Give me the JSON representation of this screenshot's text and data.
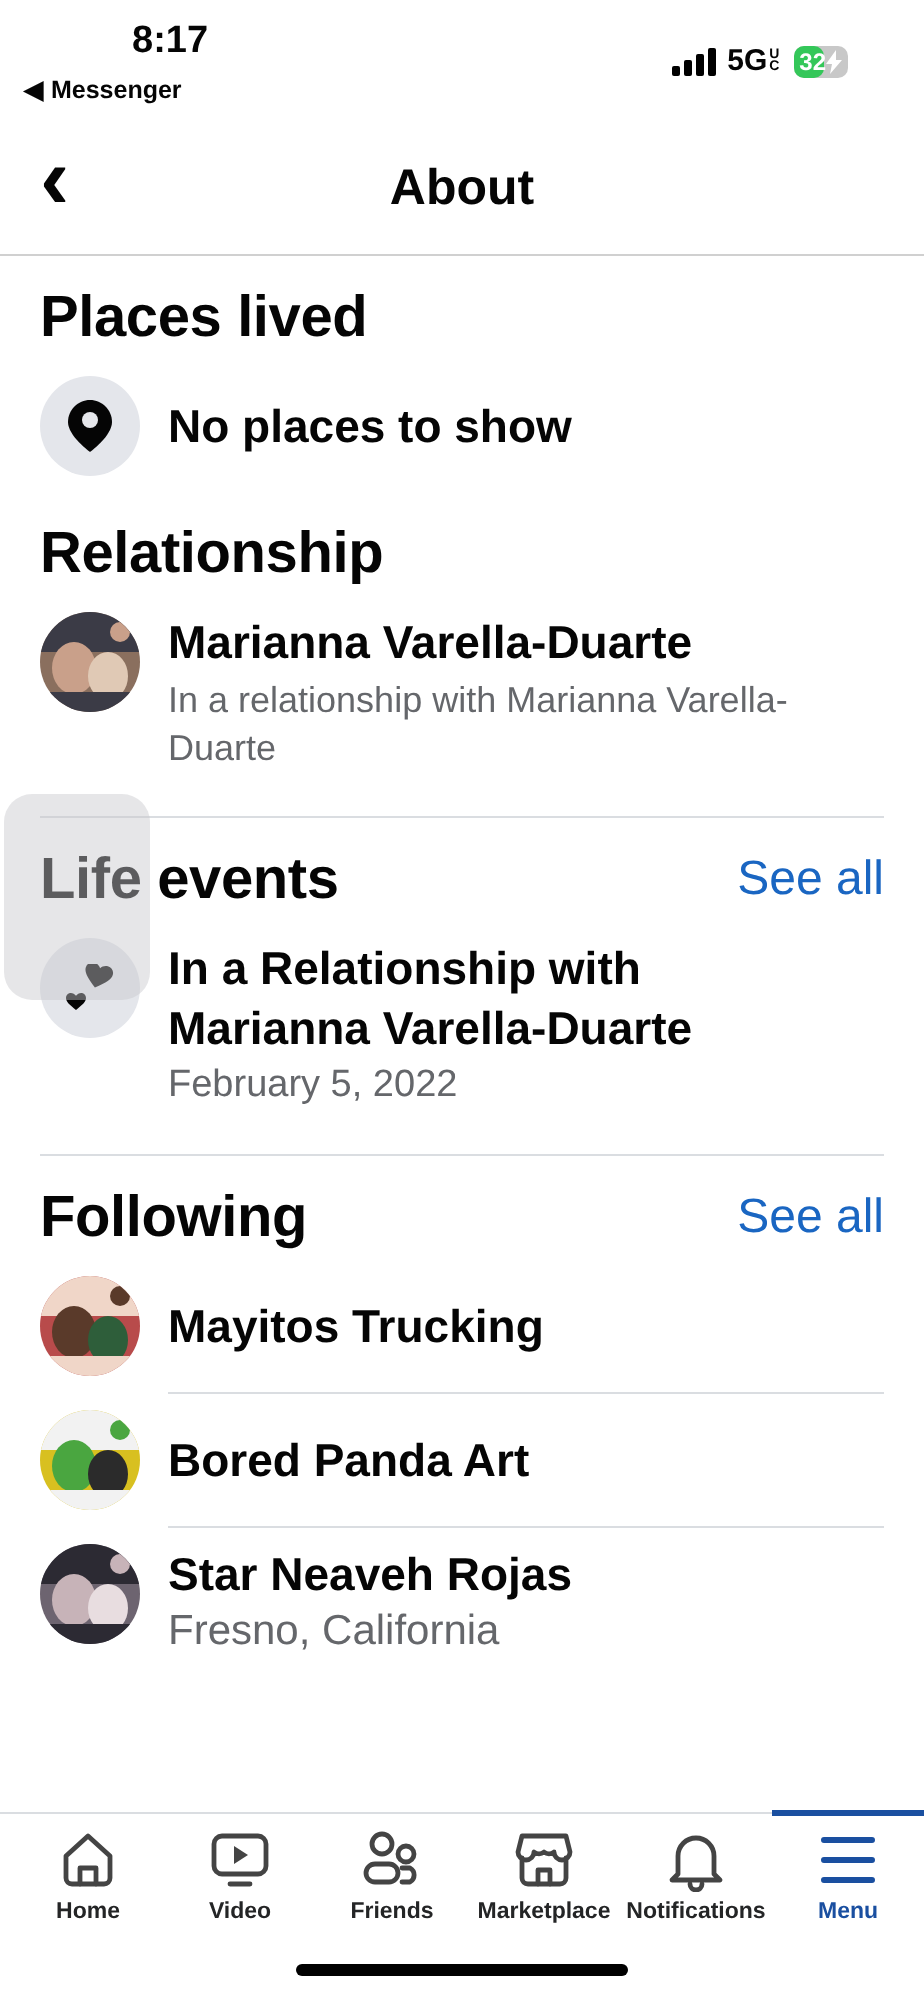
{
  "status_bar": {
    "time": "8:17",
    "back_app": "◀ Messenger",
    "network": "5G",
    "network_badge": "UC",
    "battery": "32",
    "charging": true
  },
  "header": {
    "back": "‹",
    "title": "About"
  },
  "sections": [
    {
      "heading": "Places lived",
      "divider": false,
      "items": [
        {
          "kind": "pin",
          "title": "No places to show"
        }
      ]
    },
    {
      "heading": "Relationship",
      "divider": true,
      "items": [
        {
          "kind": "picture",
          "title": "Marianna Varella-Duarte",
          "subtitle": "In a relationship with Marianna Varella-Duarte"
        }
      ]
    },
    {
      "heading": "Life events",
      "see_all": "See all",
      "divider": true,
      "items": [
        {
          "kind": "hearts",
          "title": "In a Relationship with Marianna Varella-Duarte",
          "subtitle": "February 5, 2022"
        }
      ]
    },
    {
      "heading": "Following",
      "see_all": "See all",
      "divider": false,
      "items": [
        {
          "kind": "picture",
          "title": "Mayitos Trucking"
        },
        {
          "kind": "picture",
          "title": "Bored Panda Art"
        },
        {
          "kind": "picture",
          "title": "Star Neaveh Rojas",
          "subtitle": "Fresno, California"
        }
      ]
    }
  ],
  "assistive_touch": {
    "visible": true
  },
  "tab_bar": [
    {
      "kind": "home",
      "label": "Home",
      "selected": false
    },
    {
      "kind": "video",
      "label": "Video",
      "selected": false
    },
    {
      "kind": "friends",
      "label": "Friends",
      "selected": false
    },
    {
      "kind": "marketplace",
      "label": "Marketplace",
      "selected": false
    },
    {
      "kind": "bell",
      "label": "Notifications",
      "selected": false
    },
    {
      "kind": "menu",
      "label": "Menu",
      "selected": true
    }
  ]
}
